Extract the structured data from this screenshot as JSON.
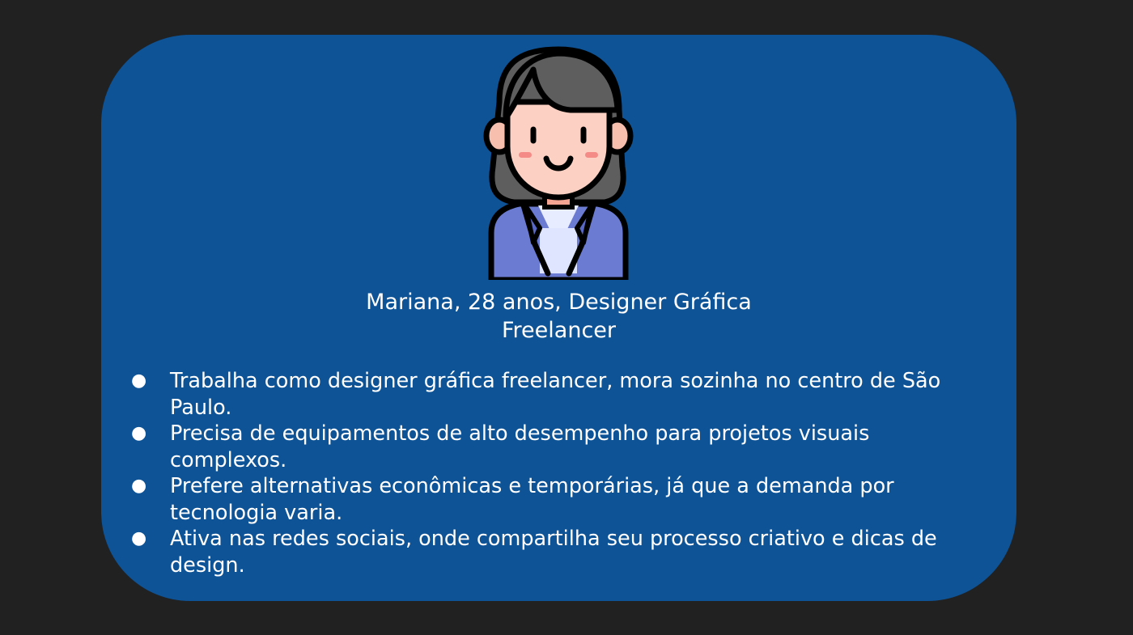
{
  "persona": {
    "title_line1": "Mariana, 28 anos, Designer Gráfica",
    "title_line2": "Freelancer",
    "avatar_icon": "woman-avatar-icon",
    "bullet_glyph": "●",
    "bullets": [
      "Trabalha como designer gráfica freelancer, mora sozinha no centro de São Paulo.",
      "Precisa de equipamentos de alto desempenho para projetos visuais complexos.",
      "Prefere alternativas econômicas e temporárias, já que a demanda por tecnologia varia.",
      "Ativa nas redes sociais, onde compartilha seu processo criativo e dicas de design."
    ]
  },
  "colors": {
    "background": "#212121",
    "card": "#0e5396",
    "text": "#ffffff"
  }
}
